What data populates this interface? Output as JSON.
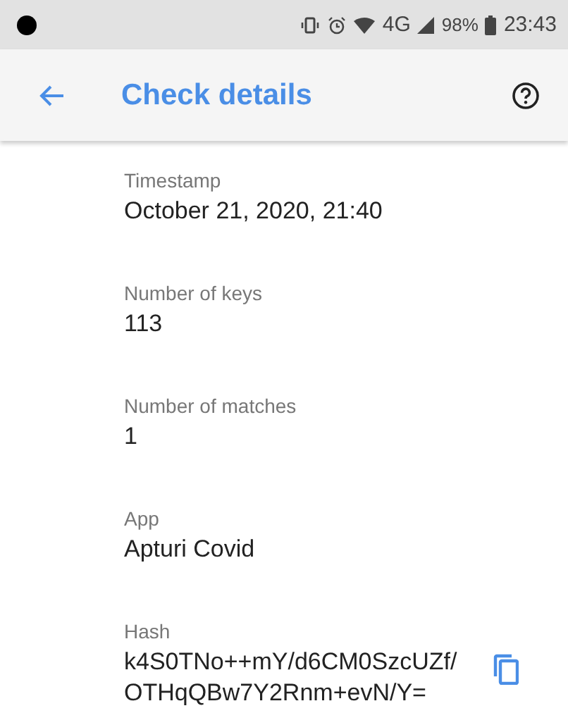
{
  "status_bar": {
    "battery": "98%",
    "time": "23:43",
    "network": "4G"
  },
  "toolbar": {
    "title": "Check details"
  },
  "fields": [
    {
      "label": "Timestamp",
      "lines": [
        "October 21, 2020, 21:40"
      ],
      "copyable": false
    },
    {
      "label": "Number of keys",
      "lines": [
        "113"
      ],
      "copyable": false
    },
    {
      "label": "Number of matches",
      "lines": [
        "1"
      ],
      "copyable": false
    },
    {
      "label": "App",
      "lines": [
        "Apturi Covid"
      ],
      "copyable": false
    },
    {
      "label": "Hash",
      "lines": [
        "k4S0TNo++mY/d6CM0SzcUZf/",
        "OTHqQBw7Y2Rnm+evN/Y="
      ],
      "copyable": true
    }
  ]
}
